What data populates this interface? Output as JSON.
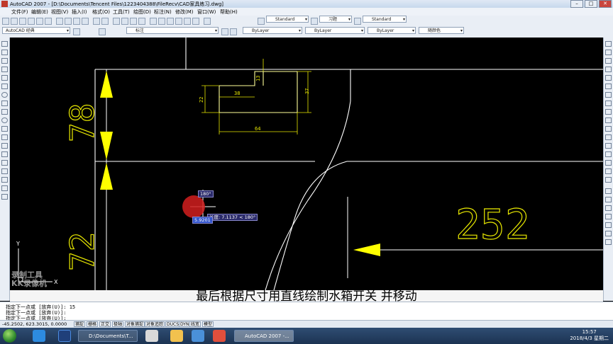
{
  "window": {
    "title": "AutoCAD 2007 - [D:\\Documents\\Tencent Files\\1223404388\\FileRecv\\CAD家具练习.dwg]"
  },
  "menu": [
    "文件(F)",
    "编辑(E)",
    "视图(V)",
    "插入(I)",
    "格式(O)",
    "工具(T)",
    "绘图(D)",
    "标注(N)",
    "修改(M)",
    "窗口(W)",
    "帮助(H)"
  ],
  "toolbar": {
    "text_style": "Standard",
    "dim_style": "习题",
    "table_style": "Standard",
    "workspace": "AutoCAD 经典",
    "layer": "标注",
    "color": "ByLayer",
    "linetype": "ByLayer",
    "lineweight": "ByLayer",
    "plotstyle": "随颜色"
  },
  "drawing": {
    "dims": {
      "top_small": "13",
      "width_38": "38",
      "height_22": "22",
      "height_37": "37",
      "width_64": "64"
    },
    "big_dims": {
      "left_upper": "78",
      "left_lower": "72",
      "right": "252"
    },
    "ucs": {
      "y": "Y",
      "x": "X"
    },
    "dynamic_input": {
      "angle": "180°",
      "length_value": "5.9201",
      "tooltip": "长度: 7.1137 < 180°"
    }
  },
  "subtitle": "最后根据尺寸用直线绘制水箱开关  并移动",
  "watermark": [
    "录制工具",
    "KK录像机"
  ],
  "command": {
    "line1": "指定下一点或 [放弃(U)]: 15",
    "line2": "指定下一点或 [放弃(U)]:",
    "line3": "指定下一点或 [放弃(U)]:"
  },
  "status": {
    "coords": "-45.2502, 623.3015, 0.0000",
    "buttons": [
      "捕捉",
      "栅格",
      "正交",
      "极轴",
      "对象捕捉",
      "对象追踪",
      "DUCS",
      "DYN",
      "线宽",
      "模型"
    ]
  },
  "taskbar": {
    "tasks": [
      "D:\\Documents\\T...",
      "AutoCAD 2007 -..."
    ],
    "time": "15:57",
    "date": "2018/4/3 星期二"
  },
  "colors": {
    "line": "#ffff99",
    "dim_yellow": "#e6e600",
    "arrow_yellow": "#ffff00",
    "white_line": "#ffffff",
    "background": "#000000"
  }
}
